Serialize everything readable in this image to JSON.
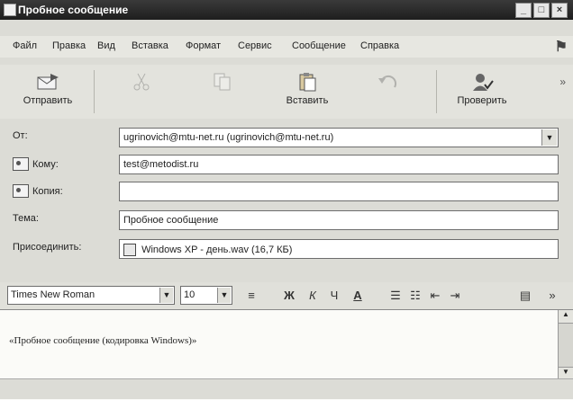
{
  "window": {
    "title": "Пробное сообщение",
    "controls": [
      "_",
      "□",
      "×"
    ]
  },
  "menu": {
    "items": [
      "Файл",
      "Правка",
      "Вид",
      "Вставка",
      "Формат",
      "Сервис",
      "Сообщение",
      "Справка"
    ]
  },
  "toolbar": {
    "send_label": "Отправить",
    "cut_label": "",
    "copy_label": "",
    "paste_label": "Вставить",
    "undo_label": "",
    "check_label": "Проверить"
  },
  "header": {
    "from_label": "От:",
    "from_value": "ugrinovich@mtu-net.ru    (ugrinovich@mtu-net.ru)",
    "to_label": "Кому:",
    "to_value": "test@metodist.ru",
    "cc_label": "Копия:",
    "cc_value": "",
    "subject_label": "Тема:",
    "subject_value": "Пробное сообщение",
    "attach_label": "Присоединить:",
    "attach_value": "Windows XP - день.wav (16,7 КБ)"
  },
  "format": {
    "font": "Times New Roman",
    "size": "10",
    "bold": "Ж",
    "italic": "К",
    "underline_glyph": "Ч",
    "font_color_glyph": "A"
  },
  "editor": {
    "text": "«Пробное сообщение (кодировка Windows)»"
  }
}
